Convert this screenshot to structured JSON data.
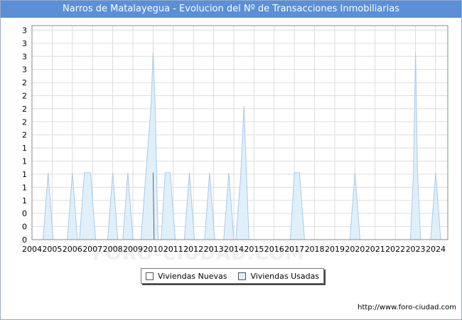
{
  "title": "Narros de Matalayegua - Evolucion del Nº de Transacciones Inmobiliarias",
  "watermark": "FORO-CIUDAD.COM",
  "source": "http://www.foro-ciudad.com",
  "legend": [
    {
      "label": "Viviendas Nuevas",
      "color": "#ffffff"
    },
    {
      "label": "Viviendas Usadas",
      "color": "#ddeefa"
    }
  ],
  "colors": {
    "nuevas_fill": "#ffffff",
    "usadas_fill": "#ddeefa",
    "usadas_stroke": "#a9c9e8",
    "grid": "#dddddd"
  },
  "chart_data": {
    "type": "area",
    "title": "Narros de Matalayegua - Evolucion del Nº de Transacciones Inmobiliarias",
    "xlabel": "",
    "ylabel": "",
    "x_ticks": [
      "2004",
      "2005",
      "2006",
      "2007",
      "2008",
      "2009",
      "2010",
      "2011",
      "2012",
      "2013",
      "2014",
      "2015",
      "2016",
      "2017",
      "2018",
      "2019",
      "2020",
      "2021",
      "2022",
      "2023",
      "2024"
    ],
    "y_ticks": [
      "0",
      "0",
      "0",
      "1",
      "1",
      "1",
      "1",
      "1",
      "2",
      "2",
      "2",
      "2",
      "2",
      "3",
      "3",
      "3",
      "3"
    ],
    "ylim": [
      0,
      3.2
    ],
    "grid": true,
    "legend_position": "bottom",
    "series": [
      {
        "name": "Viviendas Nuevas",
        "points": [
          [
            2010.0,
            1
          ],
          [
            2010.05,
            0
          ]
        ]
      },
      {
        "name": "Viviendas Usadas",
        "points": [
          [
            2004.55,
            0
          ],
          [
            2004.8,
            1
          ],
          [
            2005.05,
            0
          ],
          [
            2005.75,
            0
          ],
          [
            2006.0,
            1
          ],
          [
            2006.25,
            0
          ],
          [
            2006.35,
            0
          ],
          [
            2006.6,
            1
          ],
          [
            2006.9,
            1
          ],
          [
            2007.15,
            0
          ],
          [
            2007.75,
            0
          ],
          [
            2008.0,
            1
          ],
          [
            2008.25,
            0
          ],
          [
            2008.5,
            0
          ],
          [
            2008.75,
            1
          ],
          [
            2009.0,
            0
          ],
          [
            2009.4,
            0
          ],
          [
            2009.65,
            1
          ],
          [
            2009.9,
            2
          ],
          [
            2010.0,
            2.8
          ],
          [
            2010.1,
            2
          ],
          [
            2010.25,
            0
          ],
          [
            2010.4,
            0
          ],
          [
            2010.6,
            1
          ],
          [
            2010.85,
            1
          ],
          [
            2011.1,
            0
          ],
          [
            2011.55,
            0
          ],
          [
            2011.8,
            1
          ],
          [
            2012.05,
            0
          ],
          [
            2012.55,
            0
          ],
          [
            2012.8,
            1
          ],
          [
            2013.05,
            0
          ],
          [
            2013.5,
            0
          ],
          [
            2013.75,
            1
          ],
          [
            2014.0,
            0
          ],
          [
            2014.1,
            0
          ],
          [
            2014.35,
            1
          ],
          [
            2014.5,
            2
          ],
          [
            2014.75,
            0
          ],
          [
            2016.8,
            0
          ],
          [
            2017.0,
            1
          ],
          [
            2017.25,
            1
          ],
          [
            2017.5,
            0
          ],
          [
            2019.75,
            0
          ],
          [
            2020.0,
            1
          ],
          [
            2020.25,
            0
          ],
          [
            2022.75,
            0
          ],
          [
            2022.9,
            1
          ],
          [
            2023.0,
            2.8
          ],
          [
            2023.1,
            1
          ],
          [
            2023.25,
            0
          ],
          [
            2023.75,
            0
          ],
          [
            2024.0,
            1
          ],
          [
            2024.25,
            0
          ]
        ]
      }
    ]
  }
}
